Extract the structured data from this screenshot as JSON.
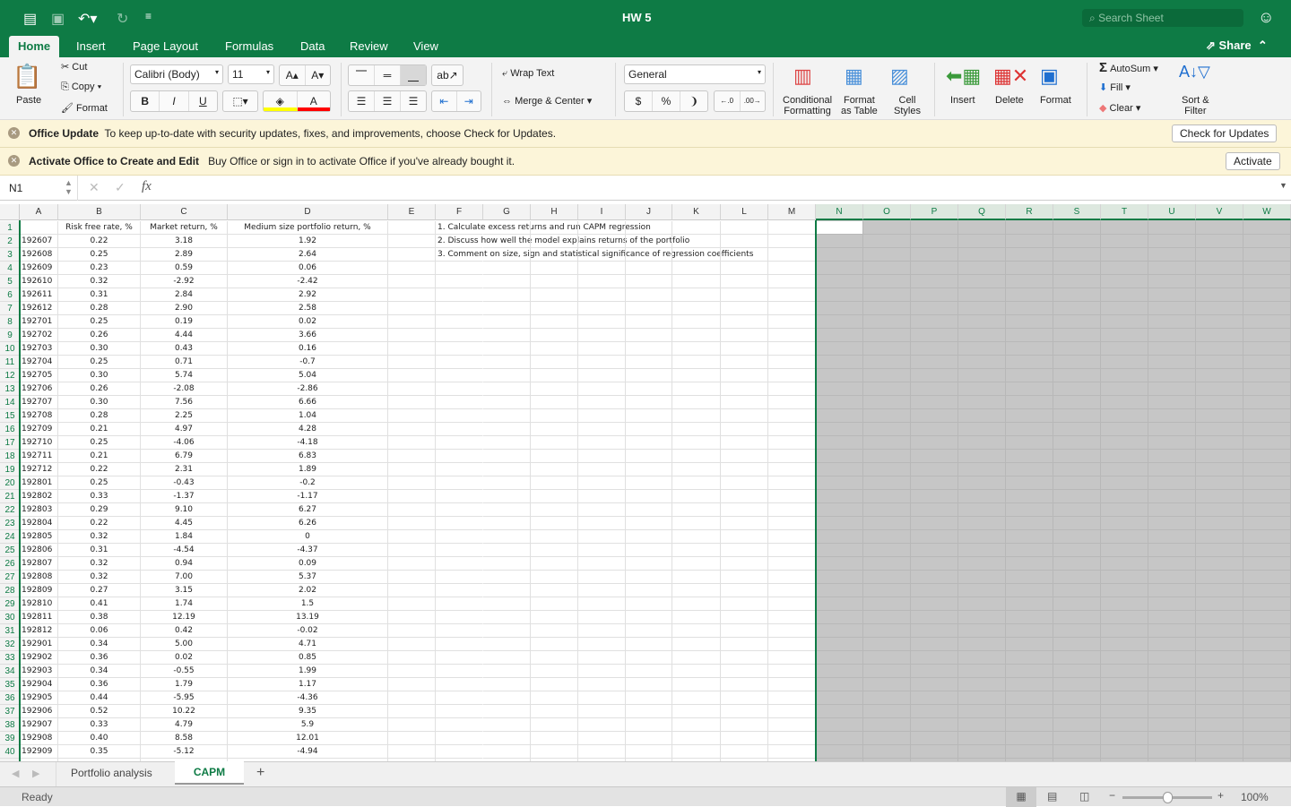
{
  "window": {
    "title": "HW 5",
    "search_placeholder": "Search Sheet"
  },
  "tabs": [
    "Home",
    "Insert",
    "Page Layout",
    "Formulas",
    "Data",
    "Review",
    "View"
  ],
  "active_tab": "Home",
  "share_label": "Share",
  "ribbon": {
    "paste": "Paste",
    "cut": "Cut",
    "copy": "Copy",
    "format_painter": "Format",
    "font_name": "Calibri (Body)",
    "font_size": "11",
    "bold": "B",
    "italic": "I",
    "underline": "U",
    "wrap_text": "Wrap Text",
    "merge_center": "Merge & Center",
    "number_format": "General",
    "currency": "$",
    "percent": "%",
    "conditional_formatting": [
      "Conditional",
      "Formatting"
    ],
    "format_as_table": [
      "Format",
      "as Table"
    ],
    "cell_styles": [
      "Cell",
      "Styles"
    ],
    "insert": "Insert",
    "delete": "Delete",
    "format": "Format",
    "autosum": "AutoSum",
    "fill": "Fill",
    "clear": "Clear",
    "sort_filter": [
      "Sort &",
      "Filter"
    ],
    "fill_color": "#ffff00",
    "font_color": "#ff0000"
  },
  "messages": [
    {
      "title": "Office Update",
      "text": "To keep up-to-date with security updates, fixes, and improvements, choose Check for Updates.",
      "button": "Check for Updates"
    },
    {
      "title": "Activate Office to Create and Edit",
      "text": "Buy Office or sign in to activate Office if you've already bought it.",
      "button": "Activate"
    }
  ],
  "formula_bar": {
    "name_box": "N1",
    "formula": ""
  },
  "columns": [
    "A",
    "B",
    "C",
    "D",
    "E",
    "F",
    "G",
    "H",
    "I",
    "J",
    "K",
    "L",
    "M",
    "N",
    "O",
    "P",
    "Q",
    "R",
    "S",
    "T",
    "U",
    "V",
    "W"
  ],
  "selected_columns": [
    "N",
    "O",
    "P",
    "Q",
    "R",
    "S",
    "T",
    "U",
    "V",
    "W"
  ],
  "headers": [
    "",
    "Risk free rate, %",
    "Market return, %",
    "Medium size portfolio return, %"
  ],
  "notes": [
    "1. Calculate excess returns and run CAPM regression",
    "2. Discuss how well the model explains returns of the portfolio",
    "3. Comment on size, sign and statistical significance of regression coefficients"
  ],
  "rows": [
    [
      "192607",
      "0.22",
      "3.18",
      "1.92"
    ],
    [
      "192608",
      "0.25",
      "2.89",
      "2.64"
    ],
    [
      "192609",
      "0.23",
      "0.59",
      "0.06"
    ],
    [
      "192610",
      "0.32",
      "-2.92",
      "-2.42"
    ],
    [
      "192611",
      "0.31",
      "2.84",
      "2.92"
    ],
    [
      "192612",
      "0.28",
      "2.90",
      "2.58"
    ],
    [
      "192701",
      "0.25",
      "0.19",
      "0.02"
    ],
    [
      "192702",
      "0.26",
      "4.44",
      "3.66"
    ],
    [
      "192703",
      "0.30",
      "0.43",
      "0.16"
    ],
    [
      "192704",
      "0.25",
      "0.71",
      "-0.7"
    ],
    [
      "192705",
      "0.30",
      "5.74",
      "5.04"
    ],
    [
      "192706",
      "0.26",
      "-2.08",
      "-2.86"
    ],
    [
      "192707",
      "0.30",
      "7.56",
      "6.66"
    ],
    [
      "192708",
      "0.28",
      "2.25",
      "1.04"
    ],
    [
      "192709",
      "0.21",
      "4.97",
      "4.28"
    ],
    [
      "192710",
      "0.25",
      "-4.06",
      "-4.18"
    ],
    [
      "192711",
      "0.21",
      "6.79",
      "6.83"
    ],
    [
      "192712",
      "0.22",
      "2.31",
      "1.89"
    ],
    [
      "192801",
      "0.25",
      "-0.43",
      "-0.2"
    ],
    [
      "192802",
      "0.33",
      "-1.37",
      "-1.17"
    ],
    [
      "192803",
      "0.29",
      "9.10",
      "6.27"
    ],
    [
      "192804",
      "0.22",
      "4.45",
      "6.26"
    ],
    [
      "192805",
      "0.32",
      "1.84",
      "0"
    ],
    [
      "192806",
      "0.31",
      "-4.54",
      "-4.37"
    ],
    [
      "192807",
      "0.32",
      "0.94",
      "0.09"
    ],
    [
      "192808",
      "0.32",
      "7.00",
      "5.37"
    ],
    [
      "192809",
      "0.27",
      "3.15",
      "2.02"
    ],
    [
      "192810",
      "0.41",
      "1.74",
      "1.5"
    ],
    [
      "192811",
      "0.38",
      "12.19",
      "13.19"
    ],
    [
      "192812",
      "0.06",
      "0.42",
      "-0.02"
    ],
    [
      "192901",
      "0.34",
      "5.00",
      "4.71"
    ],
    [
      "192902",
      "0.36",
      "0.02",
      "0.85"
    ],
    [
      "192903",
      "0.34",
      "-0.55",
      "1.99"
    ],
    [
      "192904",
      "0.36",
      "1.79",
      "1.17"
    ],
    [
      "192905",
      "0.44",
      "-5.95",
      "-4.36"
    ],
    [
      "192906",
      "0.52",
      "10.22",
      "9.35"
    ],
    [
      "192907",
      "0.33",
      "4.79",
      "5.9"
    ],
    [
      "192908",
      "0.40",
      "8.58",
      "12.01"
    ],
    [
      "192909",
      "0.35",
      "-5.12",
      "-4.94"
    ]
  ],
  "sheets": [
    "Portfolio analysis",
    "CAPM"
  ],
  "active_sheet": "CAPM",
  "status": {
    "text": "Ready",
    "zoom": "100%",
    "zoom_level": 100
  },
  "accent": "#0e7b45"
}
